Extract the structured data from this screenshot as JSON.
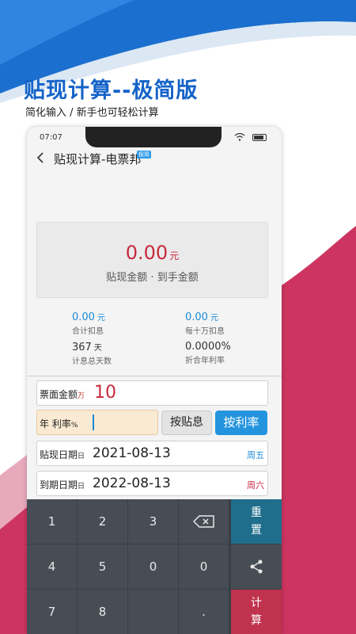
{
  "promo": {
    "title": "贴现计算--极简版",
    "subtitle": "简化输入 / 新手也可轻松计算"
  },
  "status_bar": {
    "time": "07:07"
  },
  "app_bar": {
    "title": "贴现计算-电票邦",
    "badge": "极简"
  },
  "result": {
    "amount": "0.00",
    "amount_unit": "元",
    "label": "贴现金额 · 到手金额"
  },
  "stats": {
    "total_interest": {
      "value": "0.00",
      "unit": "元",
      "label": "合计扣息"
    },
    "per_100k_interest": {
      "value": "0.00",
      "unit": "元",
      "label": "每十万扣息"
    },
    "total_days": {
      "value": "367",
      "unit": "天",
      "label": "计息总天数"
    },
    "annual_rate": {
      "value": "0.0000%",
      "label": "折合年利率"
    }
  },
  "form": {
    "face_value": {
      "label": "票面金额",
      "unit": "万",
      "value": "10"
    },
    "rate": {
      "label": "年 利率",
      "unit": "%"
    },
    "discount_date": {
      "label": "贴现日期",
      "suffix": "日",
      "value": "2021-08-13",
      "weekday": "周五"
    },
    "due_date": {
      "label": "到期日期",
      "suffix": "日",
      "value": "2022-08-13",
      "weekday": "周六"
    }
  },
  "buttons": {
    "by_discount": "按贴息",
    "by_rate": "按利率"
  },
  "keypad": {
    "keys": [
      "1",
      "2",
      "3",
      "4",
      "5",
      "0",
      "7",
      "8",
      "."
    ],
    "reset": [
      "重",
      "置"
    ],
    "calc": [
      "计",
      "算"
    ]
  },
  "colors": {
    "accent_blue": "#2594de",
    "amount_red": "#c82a3e",
    "reset_teal": "#1e6e8c",
    "calc_red": "#c0334f"
  }
}
